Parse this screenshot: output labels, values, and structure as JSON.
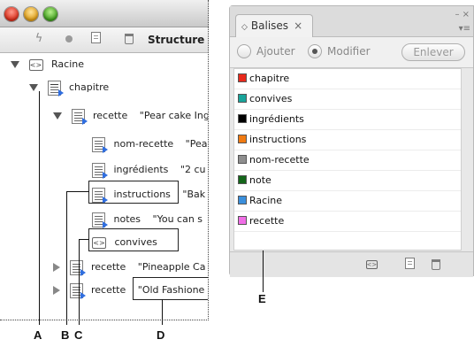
{
  "structure_panel": {
    "toolbar_label": "Structure",
    "tree": [
      {
        "label": "Racine",
        "value": ""
      },
      {
        "label": "chapitre",
        "value": ""
      },
      {
        "label": "recette",
        "value": "\"Pear cake Ing"
      },
      {
        "label": "nom-recette",
        "value": "\"Pea"
      },
      {
        "label": "ingrédients",
        "value": "\"2 cu"
      },
      {
        "label": "instructions",
        "value": "\"Bak"
      },
      {
        "label": "notes",
        "value": "\"You can s"
      },
      {
        "label": "convives",
        "value": ""
      },
      {
        "label": "recette",
        "value": "\"Pineapple Ca"
      },
      {
        "label": "recette",
        "value": "\"Old Fashione"
      }
    ]
  },
  "tags_panel": {
    "tab_title": "Balises",
    "tab_close": "×",
    "radio_add": "Ajouter",
    "radio_modify": "Modifier",
    "remove_button": "Enlever",
    "tags": [
      {
        "name": "chapitre",
        "color": "#e8291c"
      },
      {
        "name": "convives",
        "color": "#18a49a"
      },
      {
        "name": "ingrédients",
        "color": "#000000"
      },
      {
        "name": "instructions",
        "color": "#f07a12"
      },
      {
        "name": "nom-recette",
        "color": "#8e8e8e"
      },
      {
        "name": "note",
        "color": "#14661a"
      },
      {
        "name": "Racine",
        "color": "#3a8fdc"
      },
      {
        "name": "recette",
        "color": "#f06ee6"
      }
    ]
  },
  "callouts": {
    "A": "A",
    "B": "B",
    "C": "C",
    "D": "D",
    "E": "E"
  }
}
